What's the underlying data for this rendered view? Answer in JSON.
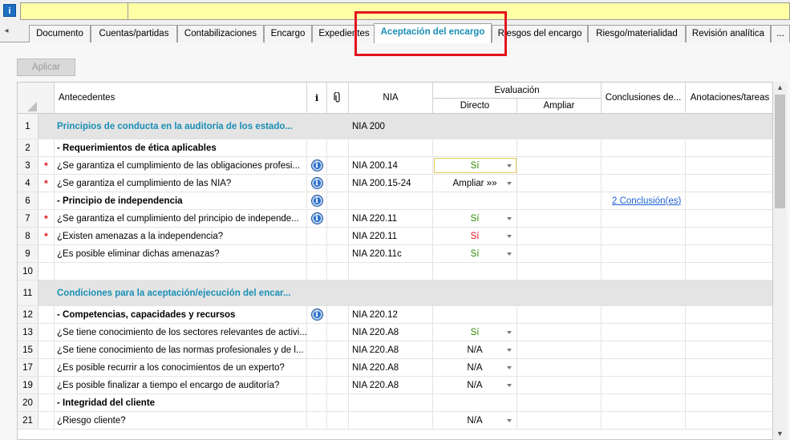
{
  "topbar": {
    "info_label": "i"
  },
  "tabs": [
    {
      "label": "Documento"
    },
    {
      "label": "Cuentas/partidas"
    },
    {
      "label": "Contabilizaciones"
    },
    {
      "label": "Encargo"
    },
    {
      "label": "Expedientes"
    },
    {
      "label": "Aceptación del encargo",
      "active": true
    },
    {
      "label": "Riesgos del encargo"
    },
    {
      "label": "Riesgo/materialidad"
    },
    {
      "label": "Revisión analítica"
    },
    {
      "label": "..."
    }
  ],
  "toolbar": {
    "apply_label": "Aplicar"
  },
  "grid": {
    "headers": {
      "antecedentes": "Antecedentes",
      "info": "i",
      "nia": "NIA",
      "evaluacion": "Evaluación",
      "directo": "Directo",
      "ampliar": "Ampliar",
      "conclusiones": "Conclusiones de...",
      "anotaciones": "Anotaciones/tareas"
    },
    "rows": [
      {
        "num": "1",
        "type": "section",
        "antecedente": "Principios de conducta en la auditoría de los estado...",
        "nia": "NIA 200"
      },
      {
        "num": "2",
        "type": "bold",
        "antecedente": "- Requerimientos de ética aplicables"
      },
      {
        "num": "3",
        "mark": "*",
        "antecedente": "¿Se garantiza el cumplimiento de las obligaciones profesi...",
        "info": true,
        "nia": "NIA 200.14",
        "directo": "Sí",
        "directo_status": "yes",
        "dropdown": true,
        "focus": true
      },
      {
        "num": "4",
        "mark": "*",
        "antecedente": "¿Se garantiza el cumplimiento de las NIA?",
        "info": true,
        "nia": "NIA 200.15-24",
        "directo": "Ampliar »»",
        "directo_status": "na",
        "dropdown": true
      },
      {
        "num": "6",
        "type": "bold",
        "antecedente": "- Principio de independencia",
        "info": true,
        "conclusion": "2 Conclusión(es)"
      },
      {
        "num": "7",
        "mark": "*",
        "antecedente": "¿Se garantiza el cumplimiento del principio de independe...",
        "info": true,
        "nia": "NIA 220.11",
        "directo": "Sí",
        "directo_status": "yes",
        "dropdown": true
      },
      {
        "num": "8",
        "mark": "*",
        "antecedente": "¿Existen amenazas a la independencia?",
        "nia": "NIA 220.11",
        "directo": "Sí",
        "directo_status": "no",
        "dropdown": true
      },
      {
        "num": "9",
        "antecedente": "¿Es posible eliminar dichas amenazas?",
        "nia": "NIA 220.11c",
        "directo": "Sí",
        "directo_status": "yes",
        "dropdown": true
      },
      {
        "num": "10",
        "antecedente": ""
      },
      {
        "num": "11",
        "type": "section",
        "antecedente": "Condiciones para la aceptación/ejecución del encar..."
      },
      {
        "num": "12",
        "type": "bold",
        "antecedente": "- Competencias, capacidades y recursos",
        "info": true,
        "nia": "NIA 220.12"
      },
      {
        "num": "13",
        "antecedente": "¿Se tiene conocimiento de los sectores relevantes de activi...",
        "nia": "NIA 220.A8",
        "directo": "Sí",
        "directo_status": "yes",
        "dropdown": true
      },
      {
        "num": "15",
        "antecedente": "¿Se tiene conocimiento de las normas profesionales y de l...",
        "nia": "NIA 220.A8",
        "directo": "N/A",
        "directo_status": "na",
        "dropdown": true
      },
      {
        "num": "17",
        "antecedente": "¿Es posible recurrir a los conocimientos de un experto?",
        "nia": "NIA 220.A8",
        "directo": "N/A",
        "directo_status": "na",
        "dropdown": true
      },
      {
        "num": "19",
        "antecedente": "¿Es posible finalizar a tiempo el encargo de auditoría?",
        "nia": "NIA 220.A8",
        "directo": "N/A",
        "directo_status": "na",
        "dropdown": true
      },
      {
        "num": "20",
        "type": "bold",
        "antecedente": "- Integridad del cliente"
      },
      {
        "num": "21",
        "antecedente": "¿Riesgo cliente?",
        "directo": "N/A",
        "directo_status": "na",
        "dropdown": true
      }
    ]
  },
  "colors": {
    "accent": "#1a8fb5",
    "highlight": "#e2141c",
    "yes": "#2e8b00",
    "no": "#e2141c"
  }
}
